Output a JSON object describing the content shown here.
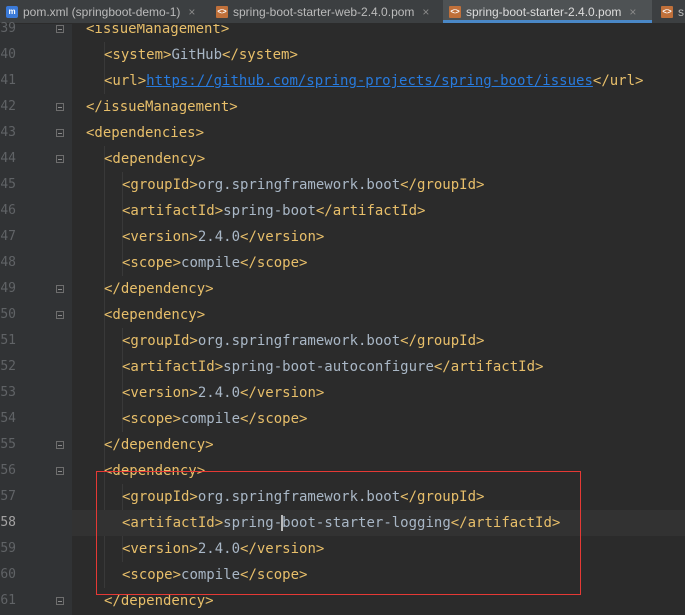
{
  "tabs": [
    {
      "label": "pom.xml (springboot-demo-1)",
      "icon": "maven-icon",
      "active": false
    },
    {
      "label": "spring-boot-starter-web-2.4.0.pom",
      "icon": "xml-file-icon",
      "active": false
    },
    {
      "label": "spring-boot-starter-2.4.0.pom",
      "icon": "xml-file-icon",
      "active": true
    },
    {
      "label": "s",
      "icon": "xml-file-icon",
      "active": false
    }
  ],
  "tab_close_glyph": "×",
  "maven_letter": "m",
  "xml_letter": "<>",
  "lines": [
    {
      "n": "39",
      "indent": 1,
      "parts": [
        {
          "t": "tag",
          "v": "<issueManagement>"
        }
      ]
    },
    {
      "n": "40",
      "indent": 2,
      "parts": [
        {
          "t": "tag",
          "v": "<system>"
        },
        {
          "t": "txt",
          "v": "GitHub"
        },
        {
          "t": "tag",
          "v": "</system>"
        }
      ]
    },
    {
      "n": "41",
      "indent": 2,
      "parts": [
        {
          "t": "tag",
          "v": "<url>"
        },
        {
          "t": "url",
          "v": "https://github.com/spring-projects/spring-boot/issues"
        },
        {
          "t": "tag",
          "v": "</url>"
        }
      ]
    },
    {
      "n": "42",
      "indent": 1,
      "parts": [
        {
          "t": "tag",
          "v": "</issueManagement>"
        }
      ]
    },
    {
      "n": "43",
      "indent": 1,
      "parts": [
        {
          "t": "tag",
          "v": "<dependencies>"
        }
      ]
    },
    {
      "n": "44",
      "indent": 2,
      "parts": [
        {
          "t": "tag",
          "v": "<dependency>"
        }
      ]
    },
    {
      "n": "45",
      "indent": 3,
      "parts": [
        {
          "t": "tag",
          "v": "<groupId>"
        },
        {
          "t": "txt",
          "v": "org.springframework.boot"
        },
        {
          "t": "tag",
          "v": "</groupId>"
        }
      ]
    },
    {
      "n": "46",
      "indent": 3,
      "parts": [
        {
          "t": "tag",
          "v": "<artifactId>"
        },
        {
          "t": "txt",
          "v": "spring-boot"
        },
        {
          "t": "tag",
          "v": "</artifactId>"
        }
      ]
    },
    {
      "n": "47",
      "indent": 3,
      "parts": [
        {
          "t": "tag",
          "v": "<version>"
        },
        {
          "t": "txt",
          "v": "2.4.0"
        },
        {
          "t": "tag",
          "v": "</version>"
        }
      ]
    },
    {
      "n": "48",
      "indent": 3,
      "parts": [
        {
          "t": "tag",
          "v": "<scope>"
        },
        {
          "t": "txt",
          "v": "compile"
        },
        {
          "t": "tag",
          "v": "</scope>"
        }
      ]
    },
    {
      "n": "49",
      "indent": 2,
      "parts": [
        {
          "t": "tag",
          "v": "</dependency>"
        }
      ]
    },
    {
      "n": "50",
      "indent": 2,
      "parts": [
        {
          "t": "tag",
          "v": "<dependency>"
        }
      ]
    },
    {
      "n": "51",
      "indent": 3,
      "parts": [
        {
          "t": "tag",
          "v": "<groupId>"
        },
        {
          "t": "txt",
          "v": "org.springframework.boot"
        },
        {
          "t": "tag",
          "v": "</groupId>"
        }
      ]
    },
    {
      "n": "52",
      "indent": 3,
      "parts": [
        {
          "t": "tag",
          "v": "<artifactId>"
        },
        {
          "t": "txt",
          "v": "spring-boot-autoconfigure"
        },
        {
          "t": "tag",
          "v": "</artifactId>"
        }
      ]
    },
    {
      "n": "53",
      "indent": 3,
      "parts": [
        {
          "t": "tag",
          "v": "<version>"
        },
        {
          "t": "txt",
          "v": "2.4.0"
        },
        {
          "t": "tag",
          "v": "</version>"
        }
      ]
    },
    {
      "n": "54",
      "indent": 3,
      "parts": [
        {
          "t": "tag",
          "v": "<scope>"
        },
        {
          "t": "txt",
          "v": "compile"
        },
        {
          "t": "tag",
          "v": "</scope>"
        }
      ]
    },
    {
      "n": "55",
      "indent": 2,
      "parts": [
        {
          "t": "tag",
          "v": "</dependency>"
        }
      ]
    },
    {
      "n": "56",
      "indent": 2,
      "parts": [
        {
          "t": "tag",
          "v": "<dependency>"
        }
      ]
    },
    {
      "n": "57",
      "indent": 3,
      "parts": [
        {
          "t": "tag",
          "v": "<groupId>"
        },
        {
          "t": "txt",
          "v": "org.springframework.boot"
        },
        {
          "t": "tag",
          "v": "</groupId>"
        }
      ]
    },
    {
      "n": "58",
      "indent": 3,
      "current": true,
      "parts": [
        {
          "t": "tag",
          "v": "<artifactId>"
        },
        {
          "t": "txt",
          "v": "spring-"
        },
        {
          "t": "caret",
          "v": ""
        },
        {
          "t": "txt",
          "v": "boot-starter-logging"
        },
        {
          "t": "tag",
          "v": "</artifactId>"
        }
      ]
    },
    {
      "n": "59",
      "indent": 3,
      "parts": [
        {
          "t": "tag",
          "v": "<version>"
        },
        {
          "t": "txt",
          "v": "2.4.0"
        },
        {
          "t": "tag",
          "v": "</version>"
        }
      ]
    },
    {
      "n": "60",
      "indent": 3,
      "parts": [
        {
          "t": "tag",
          "v": "<scope>"
        },
        {
          "t": "txt",
          "v": "compile"
        },
        {
          "t": "tag",
          "v": "</scope>"
        }
      ]
    },
    {
      "n": "61",
      "indent": 2,
      "parts": [
        {
          "t": "tag",
          "v": "</dependency>"
        }
      ]
    }
  ],
  "fold_markers_at": [
    "39",
    "42",
    "43",
    "44",
    "49",
    "50",
    "55",
    "56",
    "61"
  ],
  "current_line": "58",
  "colors": {
    "tag": "#e8bf6a",
    "text": "#a9b7c6",
    "url": "#287bde",
    "background": "#2b2b2b",
    "highlight_box": "#e53935"
  }
}
